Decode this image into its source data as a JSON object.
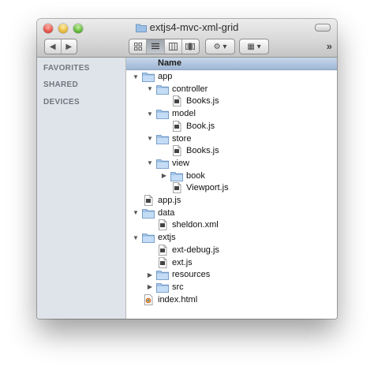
{
  "window": {
    "title": "extjs4-mvc-xml-grid"
  },
  "toolbar": {
    "back": "◀",
    "forward": "▶",
    "views": [
      "icons",
      "list",
      "columns",
      "coverflow"
    ],
    "action": "⚙ ▾",
    "arrange": "▦ ▾",
    "overflow": "»"
  },
  "sidebar": {
    "sections": [
      "FAVORITES",
      "SHARED",
      "DEVICES"
    ]
  },
  "list": {
    "header": "Name",
    "rows": [
      {
        "name": "app",
        "depth": 0,
        "type": "folder",
        "disclosure": "open"
      },
      {
        "name": "controller",
        "depth": 1,
        "type": "folder",
        "disclosure": "open"
      },
      {
        "name": "Books.js",
        "depth": 2,
        "type": "file",
        "disclosure": "none"
      },
      {
        "name": "model",
        "depth": 1,
        "type": "folder",
        "disclosure": "open"
      },
      {
        "name": "Book.js",
        "depth": 2,
        "type": "file",
        "disclosure": "none"
      },
      {
        "name": "store",
        "depth": 1,
        "type": "folder",
        "disclosure": "open"
      },
      {
        "name": "Books.js",
        "depth": 2,
        "type": "file",
        "disclosure": "none"
      },
      {
        "name": "view",
        "depth": 1,
        "type": "folder",
        "disclosure": "open"
      },
      {
        "name": "book",
        "depth": 2,
        "type": "folder",
        "disclosure": "closed"
      },
      {
        "name": "Viewport.js",
        "depth": 2,
        "type": "file",
        "disclosure": "none"
      },
      {
        "name": "app.js",
        "depth": 0,
        "type": "file",
        "disclosure": "none"
      },
      {
        "name": "data",
        "depth": 0,
        "type": "folder",
        "disclosure": "open"
      },
      {
        "name": "sheldon.xml",
        "depth": 1,
        "type": "file",
        "disclosure": "none"
      },
      {
        "name": "extjs",
        "depth": 0,
        "type": "folder",
        "disclosure": "open"
      },
      {
        "name": "ext-debug.js",
        "depth": 1,
        "type": "file",
        "disclosure": "none"
      },
      {
        "name": "ext.js",
        "depth": 1,
        "type": "file",
        "disclosure": "none"
      },
      {
        "name": "resources",
        "depth": 1,
        "type": "folder",
        "disclosure": "closed"
      },
      {
        "name": "src",
        "depth": 1,
        "type": "folder",
        "disclosure": "closed"
      },
      {
        "name": "index.html",
        "depth": 0,
        "type": "html",
        "disclosure": "none"
      }
    ]
  }
}
